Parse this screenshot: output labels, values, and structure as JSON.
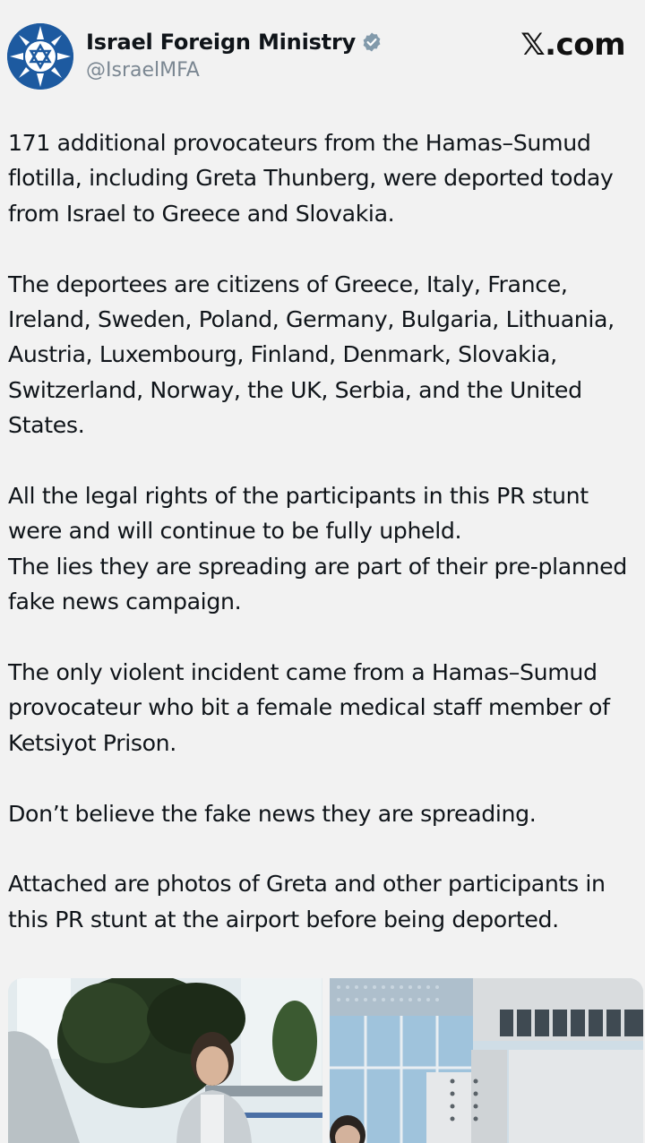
{
  "account": {
    "display_name": "Israel Foreign Ministry",
    "handle": "@IsraelMFA",
    "verified": true,
    "avatar_icon": "israel-mfa-logo-icon",
    "avatar_color": "#1d5aa0"
  },
  "brand": {
    "label": "𝕏.com"
  },
  "tweet": {
    "paragraphs": [
      "171 additional provocateurs from the Hamas–Sumud flotilla, including Greta Thunberg, were deported today from Israel to Greece and Slovakia.",
      "The deportees are citizens of Greece, Italy, France, Ireland, Sweden, Poland, Germany, Bulgaria, Lithuania, Austria, Luxembourg, Finland, Denmark, Slovakia, Switzerland, Norway, the UK, Serbia, and the United States.",
      "All the legal rights of the participants in this PR stunt were and will continue to be fully upheld.\nThe lies they are spreading are part of their pre-planned fake news campaign.",
      "The only violent incident came from a Hamas–Sumud provocateur who bit a female medical staff member of Ketsiyot Prison.",
      "Don’t believe the fake news they are spreading.",
      "Attached are photos of Greta and other participants in this PR stunt at the airport before being deported."
    ]
  },
  "media": {
    "count": 2
  },
  "colors": {
    "background": "#f2f2f2",
    "text": "#0f1419",
    "muted": "#7b8792",
    "verified_badge": "#829aab"
  }
}
